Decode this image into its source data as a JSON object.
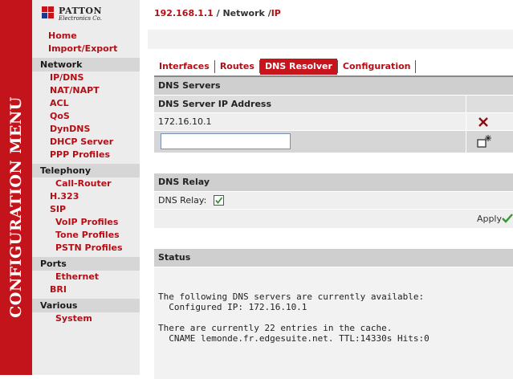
{
  "sidebar": {
    "vertical_title": "CONFIGURATION MENU",
    "logo": {
      "brand": "PATTON",
      "sub": "Electronics Co."
    },
    "items": [
      {
        "label": "Home",
        "kind": "top"
      },
      {
        "label": "Import/Export",
        "kind": "top"
      },
      {
        "label": "Network",
        "kind": "head"
      },
      {
        "label": "IP/DNS",
        "kind": "sub"
      },
      {
        "label": "NAT/NAPT",
        "kind": "sub"
      },
      {
        "label": "ACL",
        "kind": "sub"
      },
      {
        "label": "QoS",
        "kind": "sub"
      },
      {
        "label": "DynDNS",
        "kind": "sub"
      },
      {
        "label": "DHCP Server",
        "kind": "sub"
      },
      {
        "label": "PPP Profiles",
        "kind": "sub"
      },
      {
        "label": "Telephony",
        "kind": "head"
      },
      {
        "label": "Call-Router",
        "kind": "sub2"
      },
      {
        "label": "H.323",
        "kind": "sub"
      },
      {
        "label": "SIP",
        "kind": "sub"
      },
      {
        "label": "VoIP Profiles",
        "kind": "sub2"
      },
      {
        "label": "Tone Profiles",
        "kind": "sub2"
      },
      {
        "label": "PSTN Profiles",
        "kind": "sub2"
      },
      {
        "label": "Ports",
        "kind": "head"
      },
      {
        "label": "Ethernet",
        "kind": "sub2"
      },
      {
        "label": "BRI",
        "kind": "sub"
      },
      {
        "label": "Various",
        "kind": "head"
      },
      {
        "label": "System",
        "kind": "sub2"
      }
    ]
  },
  "breadcrumb": {
    "ip": "192.168.1.1",
    "sep1": " / ",
    "section": "Network",
    "sep2": " /",
    "page": "IP"
  },
  "tabs": [
    {
      "label": "Interfaces",
      "active": false
    },
    {
      "label": "Routes",
      "active": false
    },
    {
      "label": "DNS Resolver",
      "active": true
    },
    {
      "label": "Configuration",
      "active": false
    }
  ],
  "dns_servers": {
    "section_title": "DNS Servers",
    "column_header": "DNS Server IP Address",
    "entries": [
      "172.16.10.1"
    ],
    "new_entry_value": "",
    "delete_icon": "delete-x-icon",
    "add_icon": "add-new-icon"
  },
  "dns_relay": {
    "section_title": "DNS Relay",
    "label": "DNS Relay:",
    "checked": true,
    "apply_label": "Apply"
  },
  "status": {
    "section_title": "Status",
    "text": "The following DNS servers are currently available:\n  Configured IP: 172.16.10.1\n\nThere are currently 22 entries in the cache.\n  CNAME lemonde.fr.edgesuite.net. TTL:14330s Hits:0"
  },
  "colors": {
    "brand_red": "#c4141b",
    "link_red": "#b30f16",
    "active_tab": "#c8141c",
    "check_green": "#2e9a2e"
  }
}
